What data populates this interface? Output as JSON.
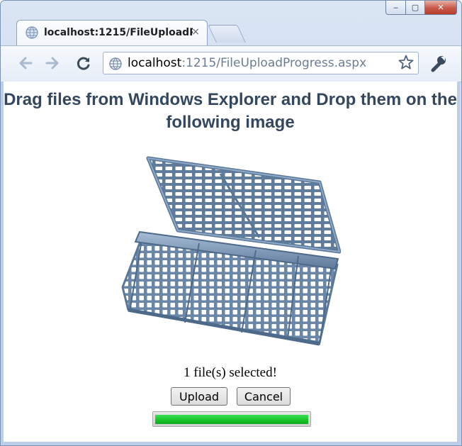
{
  "browser": {
    "tab_title": "localhost:1215/FileUploadP",
    "tab_close_glyph": "×",
    "url_host": "localhost",
    "url_rest": ":1215/FileUploadProgress.aspx",
    "icons": [
      "back-arrow-icon",
      "forward-arrow-icon",
      "reload-icon",
      "globe-icon",
      "star-icon",
      "wrench-icon"
    ],
    "window_controls": {
      "min": "‒",
      "max": "▢",
      "close": "✕"
    }
  },
  "page": {
    "heading": "Drag files from Windows Explorer and Drop them on the following image",
    "drop_target_image": "plastic-basket",
    "status_text": "1 file(s) selected!",
    "upload_label": "Upload",
    "cancel_label": "Cancel",
    "progress": 1.0,
    "progress_color": "#16c227"
  }
}
